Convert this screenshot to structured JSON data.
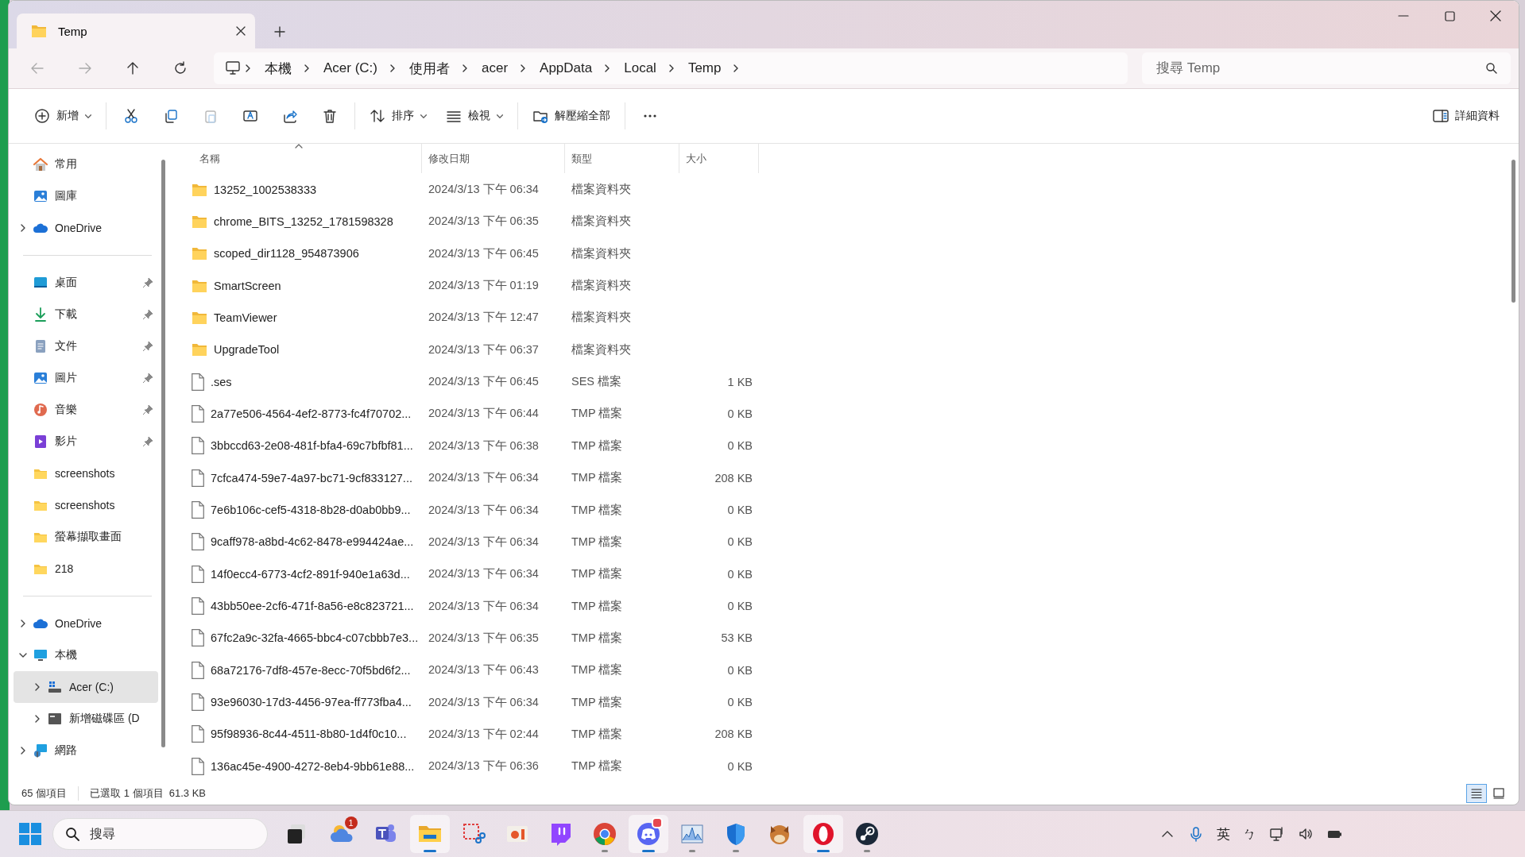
{
  "tabs": [
    {
      "title": "Temp",
      "selected": true
    }
  ],
  "nav": {
    "back_disabled": true,
    "forward_disabled": true
  },
  "breadcrumb": [
    "本機",
    "Acer (C:)",
    "使用者",
    "acer",
    "AppData",
    "Local",
    "Temp"
  ],
  "search": {
    "placeholder": "搜尋 Temp"
  },
  "toolbar": [
    {
      "kind": "menu",
      "label": "新增"
    },
    {
      "kind": "sep"
    },
    {
      "kind": "icon",
      "disabled": false
    },
    {
      "kind": "icon",
      "disabled": false
    },
    {
      "kind": "icon",
      "disabled": true
    },
    {
      "kind": "icon",
      "disabled": false
    },
    {
      "kind": "icon",
      "disabled": false
    },
    {
      "kind": "icon",
      "disabled": false
    },
    {
      "kind": "sep"
    },
    {
      "kind": "menu",
      "label": "排序"
    },
    {
      "kind": "menu",
      "label": "檢視"
    },
    {
      "kind": "sep"
    },
    {
      "kind": "button",
      "label": "解壓縮全部"
    },
    {
      "kind": "sep"
    },
    {
      "kind": "icon",
      "disabled": false
    }
  ],
  "details_button": "詳細資料",
  "sidebar": {
    "sections": [
      [
        {
          "label": "常用",
          "selected": false
        },
        {
          "label": "圖庫",
          "selected": false
        },
        {
          "label": "OneDrive",
          "expanded": false,
          "selected": false
        }
      ],
      [
        {
          "label": "桌面",
          "pinned": true,
          "selected": false
        },
        {
          "label": "下載",
          "pinned": true,
          "selected": false
        },
        {
          "label": "文件",
          "pinned": true,
          "selected": false
        },
        {
          "label": "圖片",
          "pinned": true,
          "selected": false
        },
        {
          "label": "音樂",
          "pinned": true,
          "selected": false
        },
        {
          "label": "影片",
          "pinned": true,
          "selected": false
        },
        {
          "label": "screenshots",
          "pinned": false,
          "selected": false
        },
        {
          "label": "screenshots",
          "pinned": false,
          "selected": false
        },
        {
          "label": "螢幕擷取畫面",
          "pinned": false,
          "selected": false
        },
        {
          "label": "218",
          "pinned": false,
          "selected": false
        }
      ],
      [
        {
          "label": "OneDrive",
          "expanded": false,
          "selected": false
        },
        {
          "label": "本機",
          "expanded": true,
          "selected": false,
          "children": [
            {
              "label": "Acer (C:)",
              "expanded": false,
              "selected": true
            },
            {
              "label": "新增磁碟區 (D",
              "expanded": false,
              "selected": false
            }
          ]
        },
        {
          "label": "網路",
          "expanded": false,
          "selected": false
        }
      ]
    ]
  },
  "table": {
    "columns": [
      {
        "label": "名稱",
        "sorted": true
      },
      {
        "label": "修改日期",
        "sorted": false
      },
      {
        "label": "類型",
        "sorted": false
      },
      {
        "label": "大小",
        "sorted": false
      }
    ],
    "rows": [
      {
        "kind": "folder",
        "name": "13252_1002538333",
        "date": "2024/3/13 下午 06:34",
        "type": "檔案資料夾"
      },
      {
        "kind": "folder",
        "name": "chrome_BITS_13252_1781598328",
        "date": "2024/3/13 下午 06:35",
        "type": "檔案資料夾"
      },
      {
        "kind": "folder",
        "name": "scoped_dir1128_954873906",
        "date": "2024/3/13 下午 06:45",
        "type": "檔案資料夾"
      },
      {
        "kind": "folder",
        "name": "SmartScreen",
        "date": "2024/3/13 下午 01:19",
        "type": "檔案資料夾"
      },
      {
        "kind": "folder",
        "name": "TeamViewer",
        "date": "2024/3/13 下午 12:47",
        "type": "檔案資料夾"
      },
      {
        "kind": "folder",
        "name": "UpgradeTool",
        "date": "2024/3/13 下午 06:37",
        "type": "檔案資料夾"
      },
      {
        "kind": "file",
        "name": ".ses",
        "date": "2024/3/13 下午 06:45",
        "type": "SES 檔案",
        "size": "1 KB"
      },
      {
        "kind": "file",
        "name": "2a77e506-4564-4ef2-8773-fc4f70702...",
        "date": "2024/3/13 下午 06:44",
        "type": "TMP 檔案",
        "size": "0 KB"
      },
      {
        "kind": "file",
        "name": "3bbccd63-2e08-481f-bfa4-69c7bfbf81...",
        "date": "2024/3/13 下午 06:38",
        "type": "TMP 檔案",
        "size": "0 KB"
      },
      {
        "kind": "file",
        "name": "7cfca474-59e7-4a97-bc71-9cf833127...",
        "date": "2024/3/13 下午 06:34",
        "type": "TMP 檔案",
        "size": "208 KB"
      },
      {
        "kind": "file",
        "name": "7e6b106c-cef5-4318-8b28-d0ab0bb9...",
        "date": "2024/3/13 下午 06:34",
        "type": "TMP 檔案",
        "size": "0 KB"
      },
      {
        "kind": "file",
        "name": "9caff978-a8bd-4c62-8478-e994424ae...",
        "date": "2024/3/13 下午 06:34",
        "type": "TMP 檔案",
        "size": "0 KB"
      },
      {
        "kind": "file",
        "name": "14f0ecc4-6773-4cf2-891f-940e1a63d...",
        "date": "2024/3/13 下午 06:34",
        "type": "TMP 檔案",
        "size": "0 KB"
      },
      {
        "kind": "file",
        "name": "43bb50ee-2cf6-471f-8a56-e8c823721...",
        "date": "2024/3/13 下午 06:34",
        "type": "TMP 檔案",
        "size": "0 KB"
      },
      {
        "kind": "file",
        "name": "67fc2a9c-32fa-4665-bbc4-c07cbbb7e3...",
        "date": "2024/3/13 下午 06:35",
        "type": "TMP 檔案",
        "size": "53 KB"
      },
      {
        "kind": "file",
        "name": "68a72176-7df8-457e-8ecc-70f5bd6f2...",
        "date": "2024/3/13 下午 06:43",
        "type": "TMP 檔案",
        "size": "0 KB"
      },
      {
        "kind": "file",
        "name": "93e96030-17d3-4456-97ea-ff773fba4...",
        "date": "2024/3/13 下午 06:34",
        "type": "TMP 檔案",
        "size": "0 KB"
      },
      {
        "kind": "file",
        "name": "95f98936-8c44-4511-8b80-1d4f0c10...",
        "date": "2024/3/13 下午 02:44",
        "type": "TMP 檔案",
        "size": "208 KB"
      },
      {
        "kind": "file",
        "name": "136ac45e-4900-4272-8eb4-9bb61e88...",
        "date": "2024/3/13 下午 06:36",
        "type": "TMP 檔案",
        "size": "0 KB"
      }
    ]
  },
  "status_bar": {
    "count": "65 個項目",
    "selection": "已選取 1 個項目  61.3 KB",
    "views": [
      {
        "kind": "details",
        "selected": true
      },
      {
        "kind": "tiles",
        "selected": false
      }
    ]
  },
  "taskbar": {
    "search_placeholder": "搜尋",
    "apps": [
      {
        "running": false,
        "active": false
      },
      {
        "badge": "1",
        "running": false,
        "active": false
      },
      {
        "running": false,
        "active": false
      },
      {
        "running": true,
        "active": true
      },
      {
        "running": false,
        "active": false
      },
      {
        "running": false,
        "active": false
      },
      {
        "running": false,
        "active": false
      },
      {
        "running": true,
        "active": false
      },
      {
        "running": true,
        "active": true,
        "alert": true
      },
      {
        "running": true,
        "active": false
      },
      {
        "running": true,
        "active": false
      },
      {
        "running": false,
        "active": false
      },
      {
        "running": true,
        "active": true
      },
      {
        "running": true,
        "active": false
      }
    ],
    "tray": [
      {
        "kind": "chevron"
      },
      {
        "kind": "mic"
      },
      {
        "kind": "text",
        "label": "英"
      },
      {
        "kind": "text",
        "label": "ㄅ"
      },
      {
        "kind": "network"
      },
      {
        "kind": "volume"
      },
      {
        "kind": "battery"
      }
    ]
  }
}
